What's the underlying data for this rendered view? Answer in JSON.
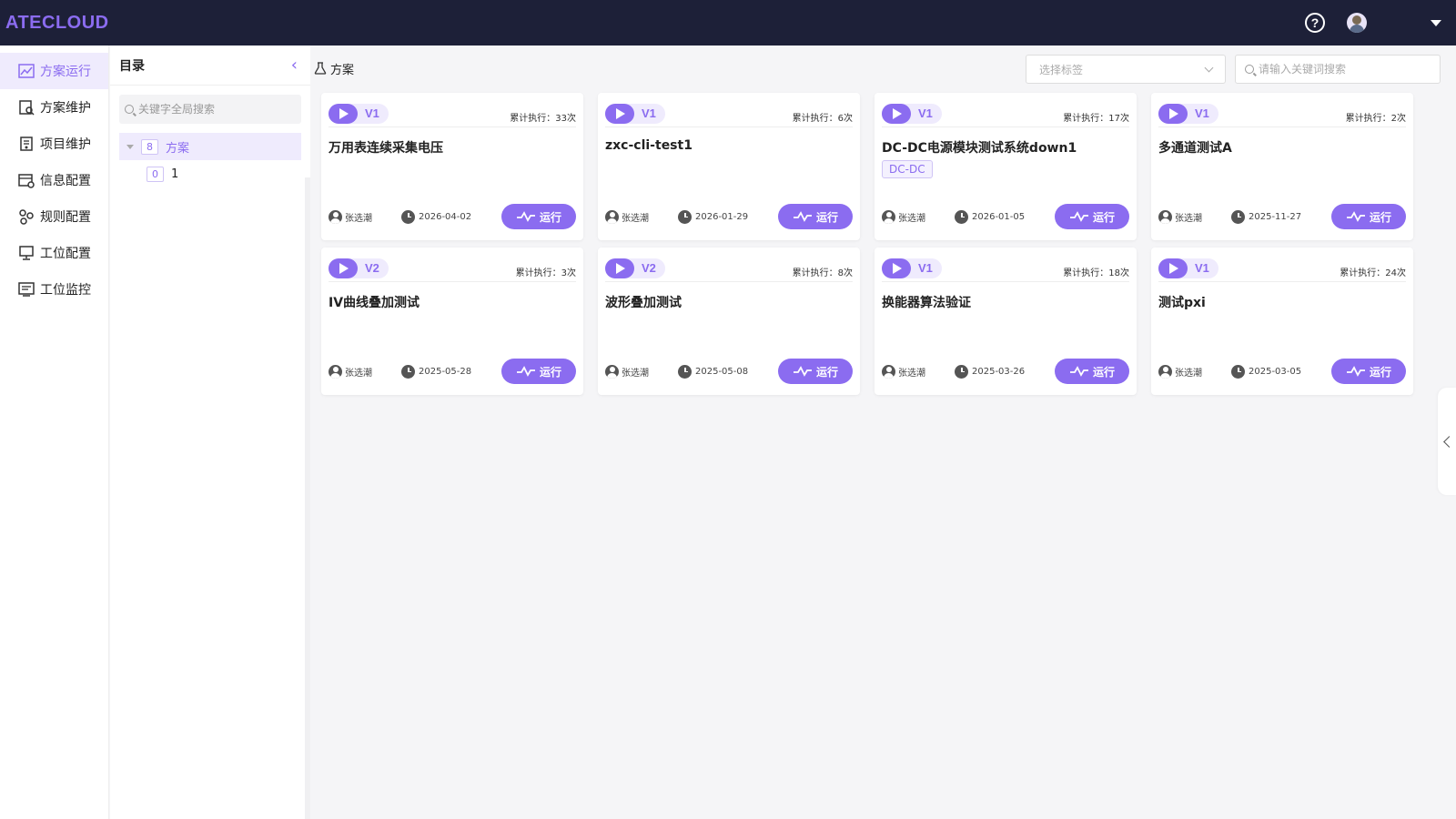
{
  "app": {
    "brand": "ATECLOUD"
  },
  "topbar": {
    "help_glyph": "?"
  },
  "sidebar": {
    "items": [
      {
        "label": "方案运行",
        "icon": "chart-line-icon",
        "active": true
      },
      {
        "label": "方案维护",
        "icon": "document-search-icon",
        "active": false
      },
      {
        "label": "项目维护",
        "icon": "project-doc-icon",
        "active": false
      },
      {
        "label": "信息配置",
        "icon": "table-gear-icon",
        "active": false
      },
      {
        "label": "规则配置",
        "icon": "nodes-icon",
        "active": false
      },
      {
        "label": "工位配置",
        "icon": "monitor-icon",
        "active": false
      },
      {
        "label": "工位监控",
        "icon": "monitor-list-icon",
        "active": false
      }
    ]
  },
  "directory": {
    "title": "目录",
    "search_placeholder": "关键字全局搜索",
    "tree": [
      {
        "count": "8",
        "label": "方案"
      },
      {
        "count": "0",
        "label": "1"
      }
    ]
  },
  "main": {
    "title": "方案",
    "tag_select_placeholder": "选择标签",
    "search_placeholder": "请输入关键词搜索",
    "run_label": "运行",
    "accent": "#8b6cf0",
    "cards": [
      {
        "version": "V1",
        "exec": "累计执行：33次",
        "name": "万用表连续采集电压",
        "tag": "",
        "author": "张选潮",
        "date": "2026-04-02"
      },
      {
        "version": "V1",
        "exec": "累计执行：6次",
        "name": "zxc-cli-test1",
        "tag": "",
        "author": "张选潮",
        "date": "2026-01-29"
      },
      {
        "version": "V1",
        "exec": "累计执行：17次",
        "name": "DC-DC电源模块测试系统down1",
        "tag": "DC-DC",
        "author": "张选潮",
        "date": "2026-01-05"
      },
      {
        "version": "V1",
        "exec": "累计执行：2次",
        "name": "多通道测试A",
        "tag": "",
        "author": "张选潮",
        "date": "2025-11-27"
      },
      {
        "version": "V2",
        "exec": "累计执行：3次",
        "name": "IV曲线叠加测试",
        "tag": "",
        "author": "张选潮",
        "date": "2025-05-28"
      },
      {
        "version": "V2",
        "exec": "累计执行：8次",
        "name": "波形叠加测试",
        "tag": "",
        "author": "张选潮",
        "date": "2025-05-08"
      },
      {
        "version": "V1",
        "exec": "累计执行：18次",
        "name": "换能器算法验证",
        "tag": "",
        "author": "张选潮",
        "date": "2025-03-26"
      },
      {
        "version": "V1",
        "exec": "累计执行：24次",
        "name": "测试pxi",
        "tag": "",
        "author": "张选潮",
        "date": "2025-03-05"
      }
    ]
  }
}
